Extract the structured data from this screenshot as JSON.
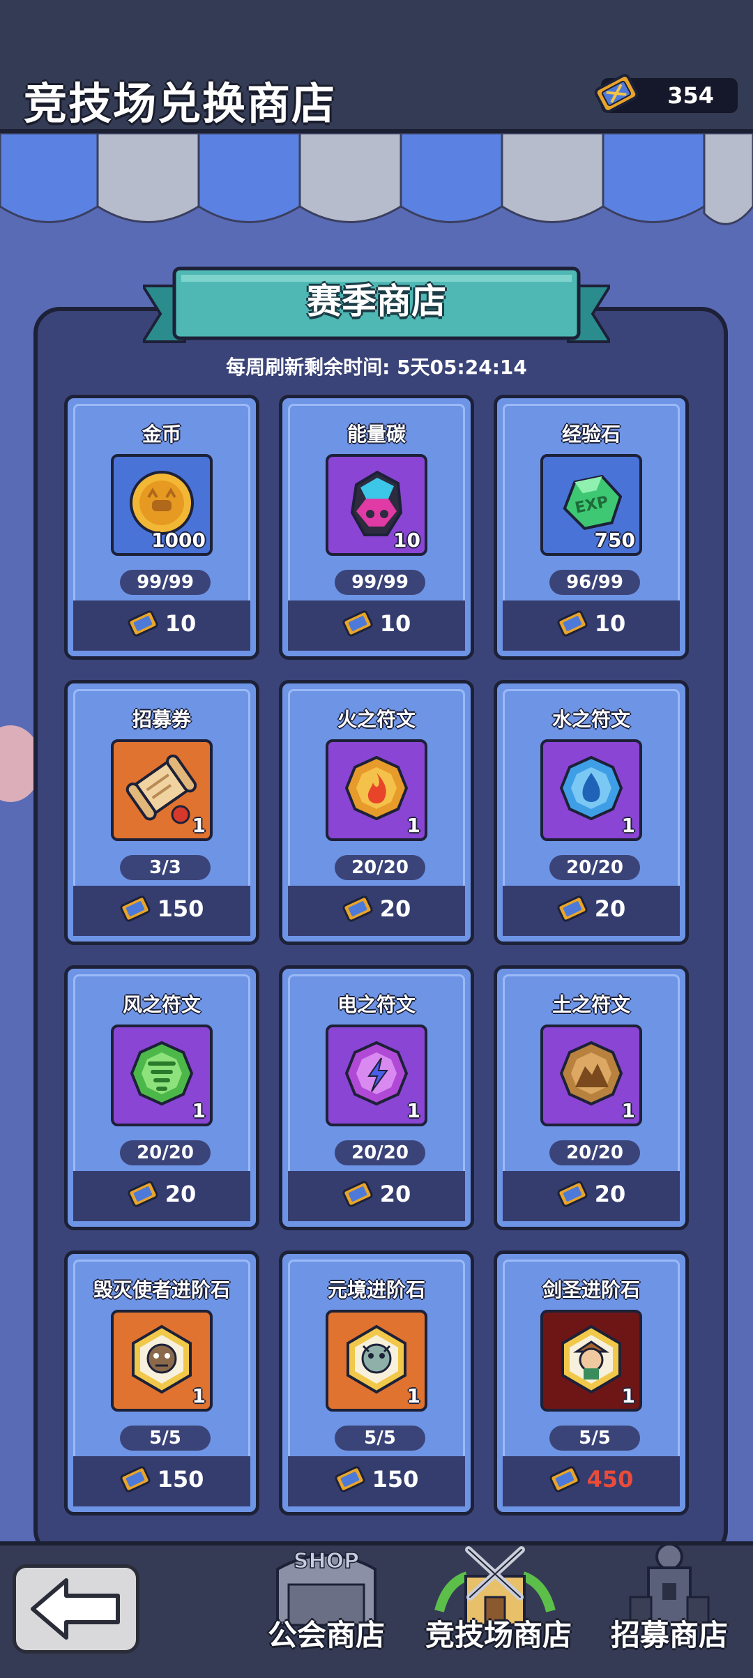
{
  "header": {
    "title": "竞技场兑换商店",
    "currency_amount": "354",
    "currency_icon": "arena-ticket-icon"
  },
  "shop": {
    "banner_title": "赛季商店",
    "refresh_label": "每周刷新剩余时间:",
    "refresh_time": "5天05:24:14"
  },
  "items": [
    {
      "name": "金币",
      "icon": "gold-coin-icon",
      "qty": "1000",
      "stock": "99/99",
      "price": "10"
    },
    {
      "name": "能量碳",
      "icon": "energy-carbon-icon",
      "qty": "10",
      "stock": "99/99",
      "price": "10"
    },
    {
      "name": "经验石",
      "icon": "exp-stone-icon",
      "qty": "750",
      "stock": "96/99",
      "price": "10"
    },
    {
      "name": "招募券",
      "icon": "recruit-scroll-icon",
      "qty": "1",
      "stock": "3/3",
      "price": "150"
    },
    {
      "name": "火之符文",
      "icon": "fire-rune-icon",
      "qty": "1",
      "stock": "20/20",
      "price": "20"
    },
    {
      "name": "水之符文",
      "icon": "water-rune-icon",
      "qty": "1",
      "stock": "20/20",
      "price": "20"
    },
    {
      "name": "风之符文",
      "icon": "wind-rune-icon",
      "qty": "1",
      "stock": "20/20",
      "price": "20"
    },
    {
      "name": "电之符文",
      "icon": "lightning-rune-icon",
      "qty": "1",
      "stock": "20/20",
      "price": "20"
    },
    {
      "name": "土之符文",
      "icon": "earth-rune-icon",
      "qty": "1",
      "stock": "20/20",
      "price": "20"
    },
    {
      "name": "毁灭使者进阶石",
      "icon": "destroyer-advance-stone-icon",
      "qty": "1",
      "stock": "5/5",
      "price": "150"
    },
    {
      "name": "元境进阶石",
      "icon": "yuanjing-advance-stone-icon",
      "qty": "1",
      "stock": "5/5",
      "price": "150"
    },
    {
      "name": "剑圣进阶石",
      "icon": "swordmaster-advance-stone-icon",
      "qty": "1",
      "stock": "5/5",
      "price": "450"
    }
  ],
  "nav": {
    "back_icon": "back-arrow-icon",
    "guild_shop": "公会商店",
    "shop_badge": "SHOP",
    "arena_shop": "竞技场商店",
    "recruit_shop": "招募商店"
  },
  "colors": {
    "background": "#5a6bb6",
    "header": "#343b55",
    "card": "#6e94e6",
    "price_bar": "#353d6f",
    "unaffordable_price": "#e94c3a"
  }
}
